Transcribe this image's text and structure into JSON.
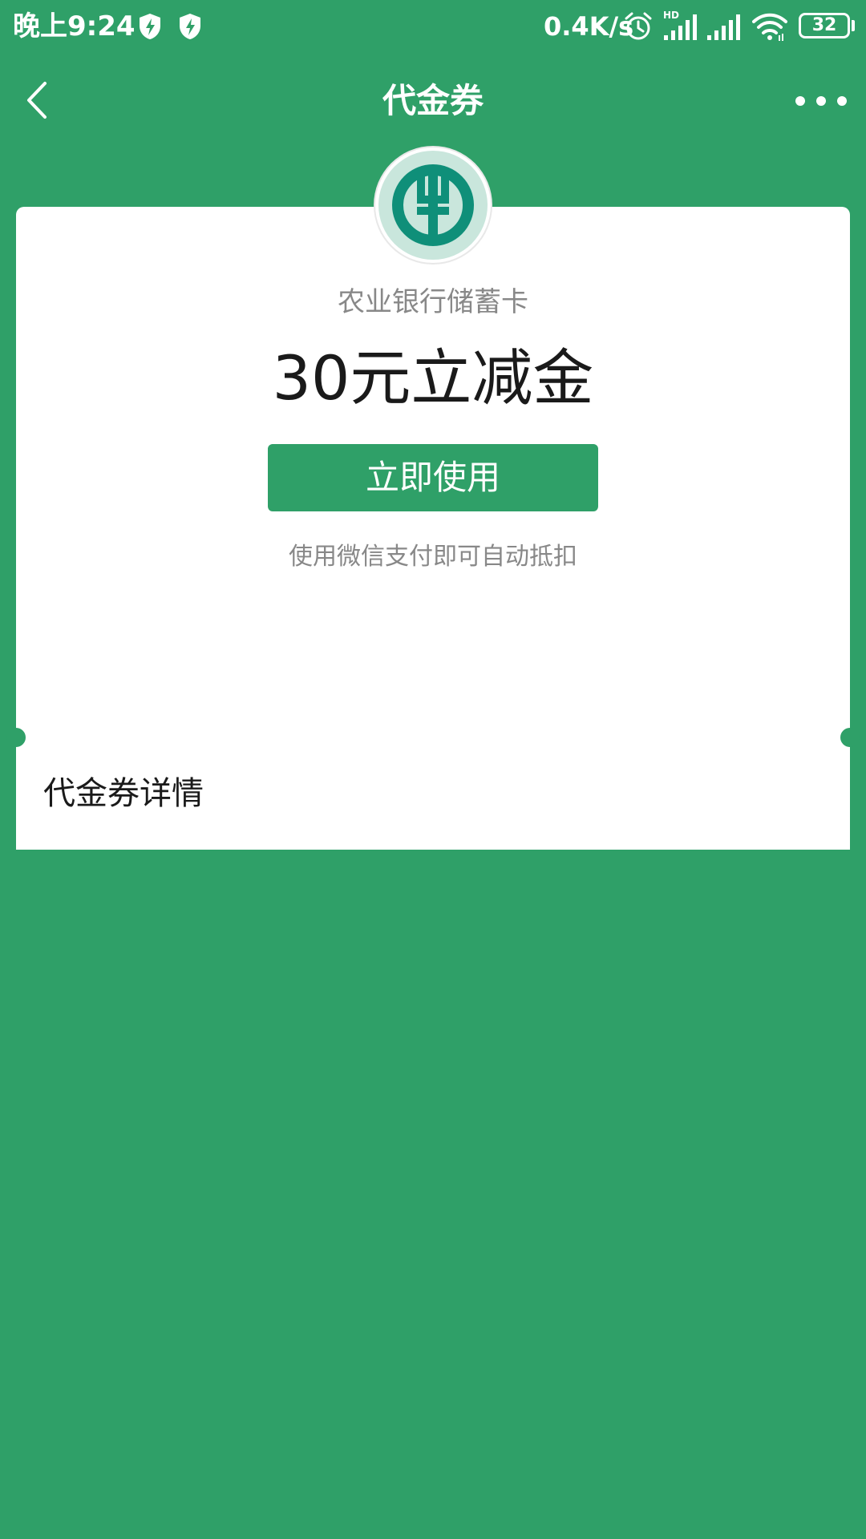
{
  "status_bar": {
    "time": "晚上9:24",
    "network_speed": "0.4K/s",
    "network_type": "HD",
    "battery": "32",
    "icons": [
      "shield-bolt-icon",
      "shield-bolt-icon",
      "alarm-icon",
      "signal-icon",
      "signal-icon",
      "wifi-icon",
      "battery-icon"
    ]
  },
  "nav": {
    "title": "代金券",
    "back_icon": "chevron-left-icon",
    "more_icon": "more-dots-icon"
  },
  "coupon": {
    "bank_logo": "abc-bank-logo",
    "bank_name": "农业银行储蓄卡",
    "amount_title": "30元立减金",
    "use_button": "立即使用",
    "hint": "使用微信支付即可自动抵扣",
    "details_title": "代金券详情"
  },
  "colors": {
    "background": "#2fa068",
    "card": "#ffffff",
    "logo_teal": "#0f8f79",
    "text_primary": "#1a1a1a",
    "text_secondary": "#888888"
  }
}
